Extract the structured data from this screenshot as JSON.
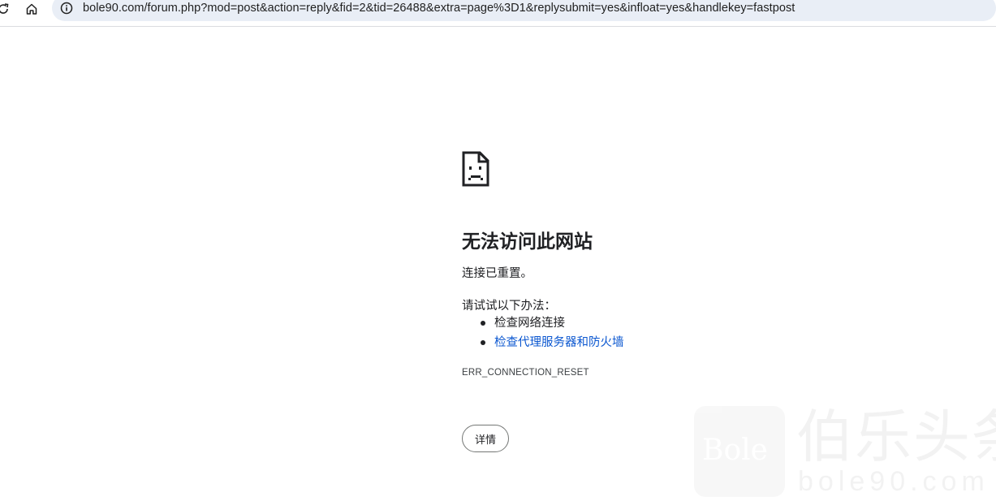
{
  "browser": {
    "url": "bole90.com/forum.php?mod=post&action=reply&fid=2&tid=26488&extra=page%3D1&replysubmit=yes&infloat=yes&handlekey=fastpost",
    "icons": [
      "reload-icon",
      "home-icon",
      "site-info-icon"
    ]
  },
  "error_page": {
    "icon": "sad-page-icon",
    "title": "无法访问此网站",
    "subtitle": "连接已重置。",
    "try_heading": "请试试以下办法：",
    "suggestions": [
      {
        "label": "检查网络连接",
        "is_link": false
      },
      {
        "label": "检查代理服务器和防火墙",
        "is_link": true
      }
    ],
    "error_code": "ERR_CONNECTION_RESET",
    "details_button": "详情"
  },
  "watermark": {
    "logo_text": "Bole",
    "cn_text": "伯乐头条",
    "en_text": "bole90.com"
  },
  "colors": {
    "omnibox_bg": "#e9eef6",
    "link": "#0b57d0",
    "text": "#202124"
  }
}
